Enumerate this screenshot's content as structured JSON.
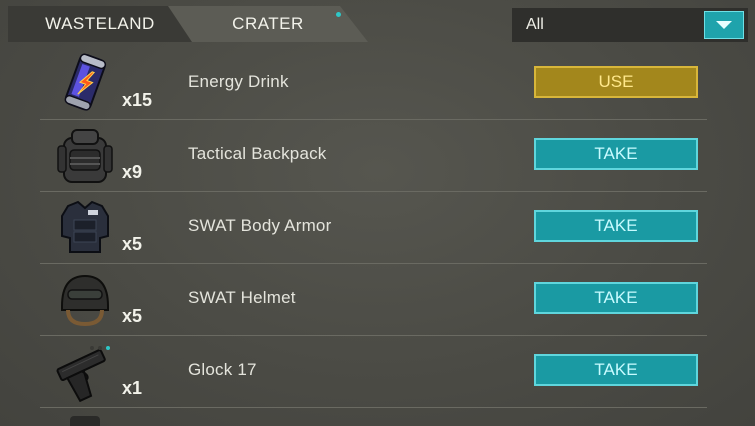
{
  "tabs": [
    {
      "label": "WASTELAND",
      "active": false
    },
    {
      "label": "CRATER",
      "active": true
    }
  ],
  "filter": {
    "value": "All"
  },
  "colors": {
    "use_button": "#a3871c",
    "take_button": "#1a9aa3",
    "accent": "#2ec7c7"
  },
  "items": [
    {
      "name": "Energy Drink",
      "qty": "x15",
      "action": "USE",
      "icon": "energy-drink-icon"
    },
    {
      "name": "Tactical Backpack",
      "qty": "x9",
      "action": "TAKE",
      "icon": "backpack-icon"
    },
    {
      "name": "SWAT Body Armor",
      "qty": "x5",
      "action": "TAKE",
      "icon": "body-armor-icon"
    },
    {
      "name": "SWAT Helmet",
      "qty": "x5",
      "action": "TAKE",
      "icon": "helmet-icon"
    },
    {
      "name": "Glock 17",
      "qty": "x1",
      "action": "TAKE",
      "icon": "pistol-icon"
    }
  ]
}
